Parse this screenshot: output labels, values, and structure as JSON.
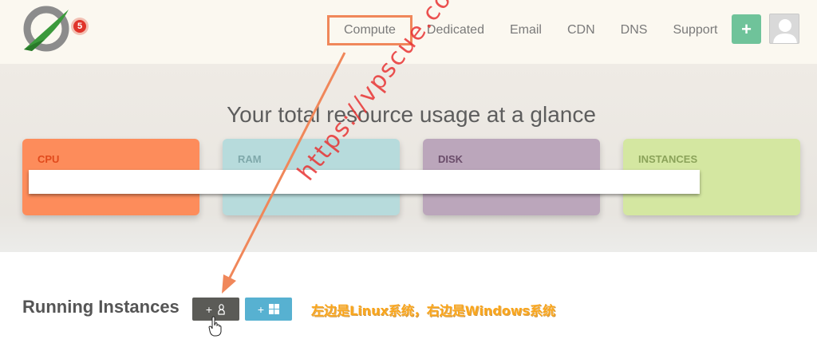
{
  "header": {
    "notification_count": "5",
    "nav": [
      {
        "label": "Compute",
        "active": true
      },
      {
        "label": "Dedicated",
        "active": false
      },
      {
        "label": "Email",
        "active": false
      },
      {
        "label": "CDN",
        "active": false
      },
      {
        "label": "DNS",
        "active": false
      },
      {
        "label": "Support",
        "active": false
      }
    ],
    "add_label": "+",
    "icons": {
      "logo": "brand-logo",
      "add": "plus-icon",
      "avatar": "user-avatar-icon"
    }
  },
  "hero": {
    "title": "Your total resource usage at a glance",
    "cards": [
      {
        "label": "CPU",
        "color": "#fd8c5b"
      },
      {
        "label": "RAM",
        "color": "#b7dbdc"
      },
      {
        "label": "DISK",
        "color": "#bba6bb"
      },
      {
        "label": "INSTANCES",
        "color": "#d4e7a1"
      }
    ]
  },
  "instances": {
    "title": "Running Instances",
    "linux_button": {
      "plus": "+",
      "icon": "linux-tux-icon"
    },
    "windows_button": {
      "plus": "+",
      "icon": "windows-logo-icon"
    }
  },
  "annotation": {
    "note": "左边是Linux系统，右边是Windows系统",
    "watermark": "https://vpscue.com",
    "highlight_color": "#f0875a"
  }
}
